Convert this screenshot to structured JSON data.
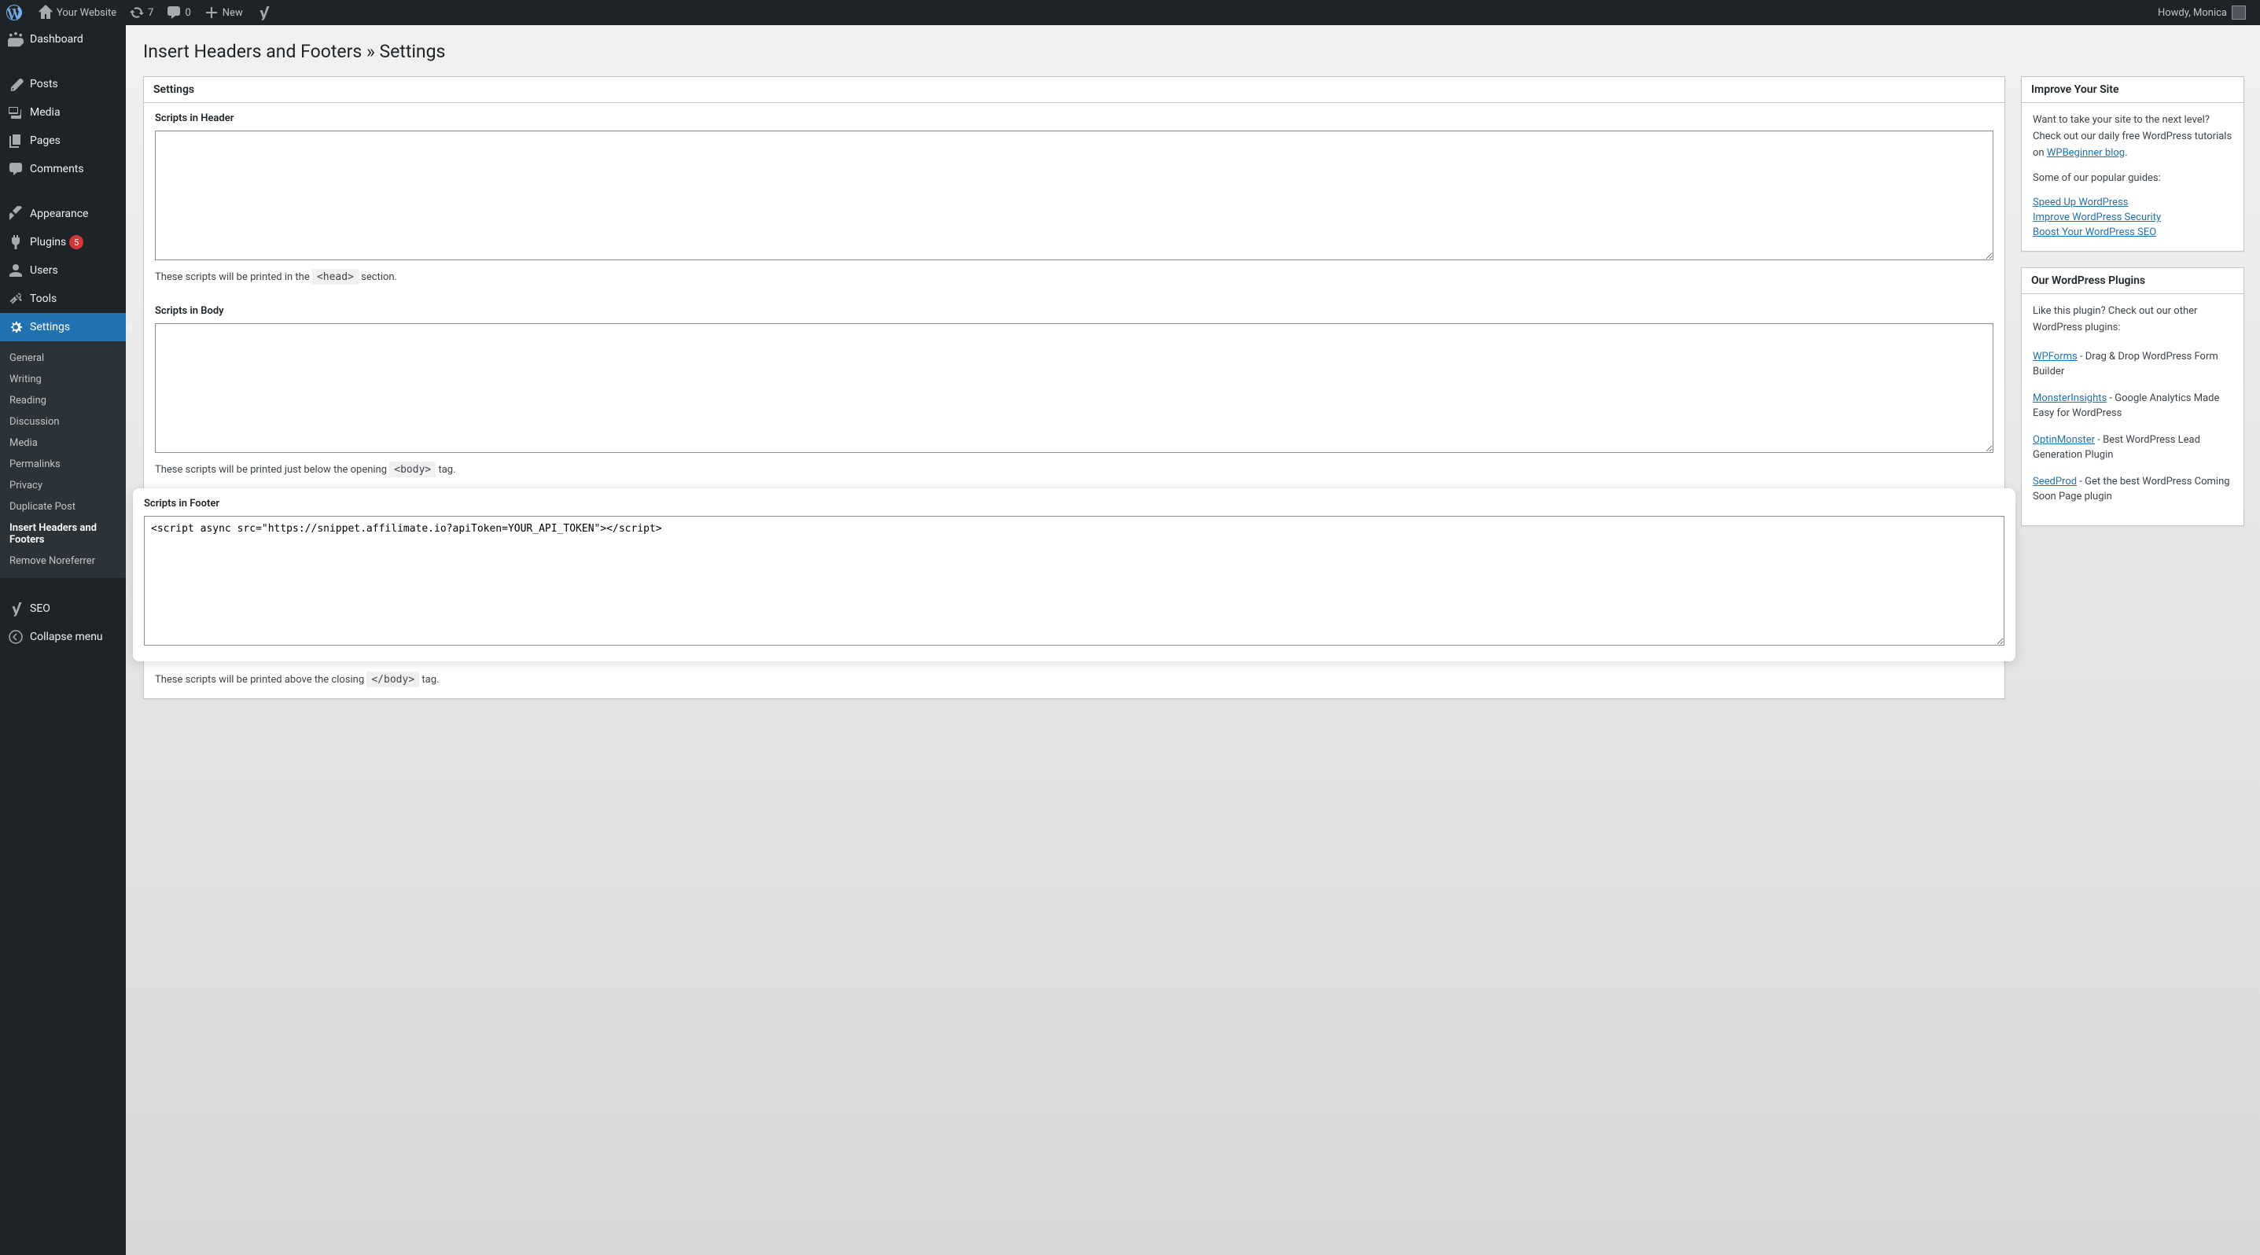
{
  "adminbar": {
    "site_name": "Your Website",
    "updates": "7",
    "comments": "0",
    "new_label": "New",
    "howdy": "Howdy, Monica"
  },
  "sidebar": {
    "dashboard": "Dashboard",
    "posts": "Posts",
    "media": "Media",
    "pages": "Pages",
    "comments": "Comments",
    "appearance": "Appearance",
    "plugins": "Plugins",
    "plugins_count": "5",
    "users": "Users",
    "tools": "Tools",
    "settings": "Settings",
    "seo": "SEO",
    "collapse": "Collapse menu",
    "sub": {
      "general": "General",
      "writing": "Writing",
      "reading": "Reading",
      "discussion": "Discussion",
      "media": "Media",
      "permalinks": "Permalinks",
      "privacy": "Privacy",
      "duplicate_post": "Duplicate Post",
      "insert_headers": "Insert Headers and Footers",
      "remove_noreferrer": "Remove Noreferrer"
    }
  },
  "page": {
    "title": "Insert Headers and Footers » Settings",
    "settings_heading": "Settings",
    "header": {
      "label": "Scripts in Header",
      "value": "",
      "descr_a": "These scripts will be printed in the ",
      "descr_code": "<head>",
      "descr_b": " section."
    },
    "body": {
      "label": "Scripts in Body",
      "value": "",
      "descr_a": "These scripts will be printed just below the opening ",
      "descr_code": "<body>",
      "descr_b": " tag."
    },
    "footer": {
      "label": "Scripts in Footer",
      "value": "<script async src=\"https://snippet.affilimate.io?apiToken=YOUR_API_TOKEN\"></script>",
      "descr_a": "These scripts will be printed above the closing ",
      "descr_code": "</body>",
      "descr_b": " tag."
    }
  },
  "improve": {
    "title": "Improve Your Site",
    "intro_a": "Want to take your site to the next level? Check out our daily free WordPress tutorials on ",
    "intro_link": "WPBeginner blog",
    "intro_b": ".",
    "guides": "Some of our popular guides:",
    "link1": "Speed Up WordPress",
    "link2": "Improve WordPress Security",
    "link3": "Boost Your WordPress SEO"
  },
  "ourplugins": {
    "title": "Our WordPress Plugins",
    "intro": "Like this plugin? Check out our other WordPress plugins:",
    "p1_name": "WPForms",
    "p1_desc": " - Drag & Drop WordPress Form Builder",
    "p2_name": "MonsterInsights",
    "p2_desc": " - Google Analytics Made Easy for WordPress",
    "p3_name": "OptinMonster",
    "p3_desc": " - Best WordPress Lead Generation Plugin",
    "p4_name": "SeedProd",
    "p4_desc": " - Get the best WordPress Coming Soon Page plugin"
  }
}
